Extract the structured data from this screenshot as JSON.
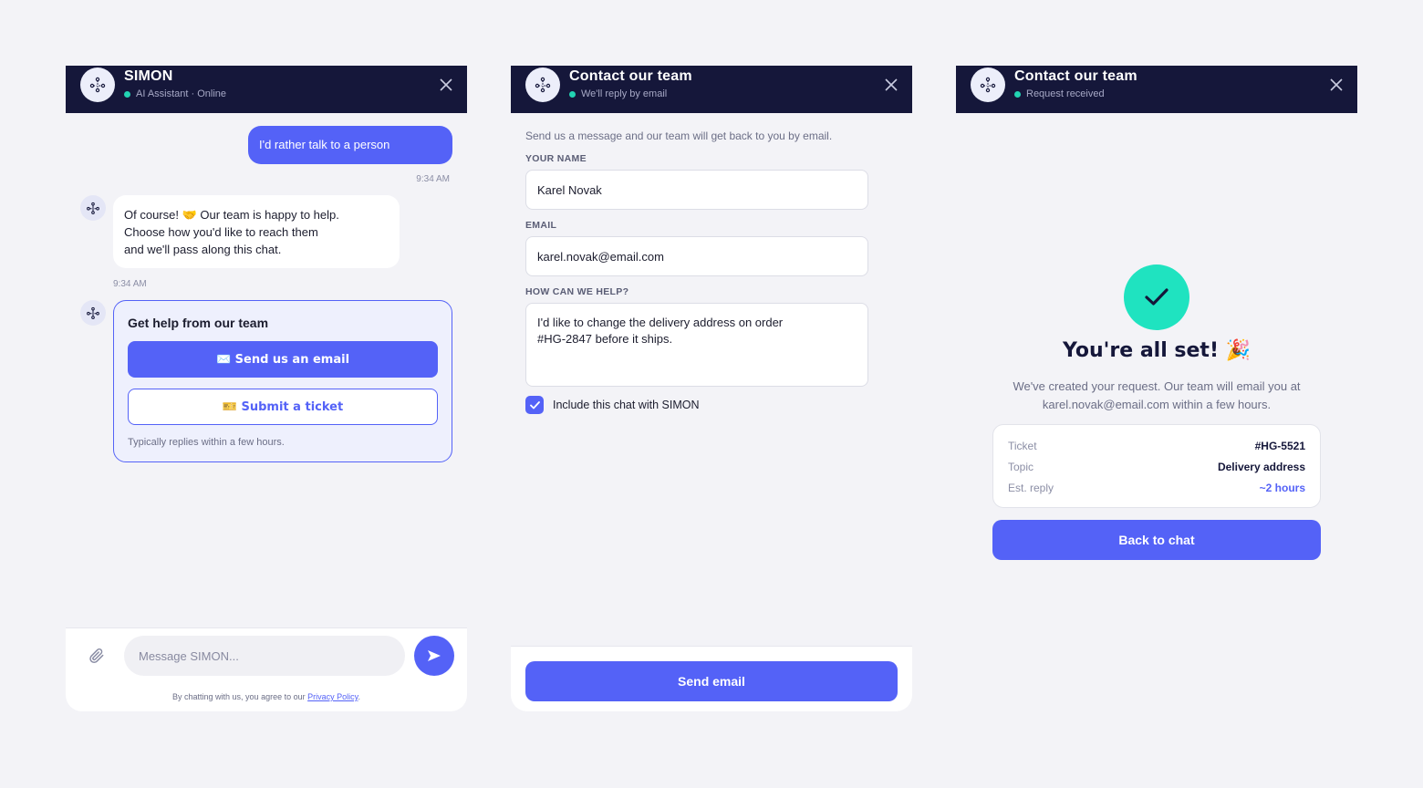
{
  "colors": {
    "header_bg": "#15173a",
    "accent": "#5462f7",
    "online": "#22d3b2",
    "success": "#1fe3c0",
    "page_bg": "#f3f3f7"
  },
  "chat_panel": {
    "title": "SIMON",
    "subtitle": "AI Assistant · Online",
    "user_message": "I'd rather talk to a person",
    "user_time": "9:34 AM",
    "bot_message_line1": "Of course! 🤝 Our team is happy to help.",
    "bot_message_line2": "Choose how you'd like to reach them",
    "bot_message_line3": "and we'll pass along this chat.",
    "bot_time": "9:34 AM",
    "help_card": {
      "title": "Get help from our team",
      "email_button": "✉️ Send us an email",
      "ticket_button": "🎫 Submit a ticket",
      "note": "Typically replies within a few hours."
    },
    "composer": {
      "placeholder": "Message SIMON...",
      "privacy_prefix": "By chatting with us, you agree to our ",
      "privacy_link": "Privacy Policy",
      "privacy_suffix": "."
    }
  },
  "contact_panel": {
    "title": "Contact our team",
    "subtitle": "We'll reply by email",
    "intro": "Send us a message and our team will get back to you by email.",
    "name_label": "YOUR NAME",
    "name_value": "Karel Novak",
    "email_label": "EMAIL",
    "email_value": "karel.novak@email.com",
    "help_label": "HOW CAN WE HELP?",
    "help_value_line1": "I'd like to change the delivery address on order",
    "help_value_line2": "#HG-2847 before it ships.",
    "include_chat_label": "Include this chat with SIMON",
    "include_chat_checked": true,
    "send_button": "Send email"
  },
  "success_panel": {
    "title": "Contact our team",
    "subtitle": "Request received",
    "heading": "You're all set! 🎉",
    "message_line1": "We've created your request. Our team will email you at",
    "message_line2": "karel.novak@email.com within a few hours.",
    "ticket": {
      "ticket_key": "Ticket",
      "ticket_val": "#HG-5521",
      "topic_key": "Topic",
      "topic_val": "Delivery address",
      "reply_key": "Est. reply",
      "reply_val": "~2 hours"
    },
    "back_button": "Back to chat"
  }
}
